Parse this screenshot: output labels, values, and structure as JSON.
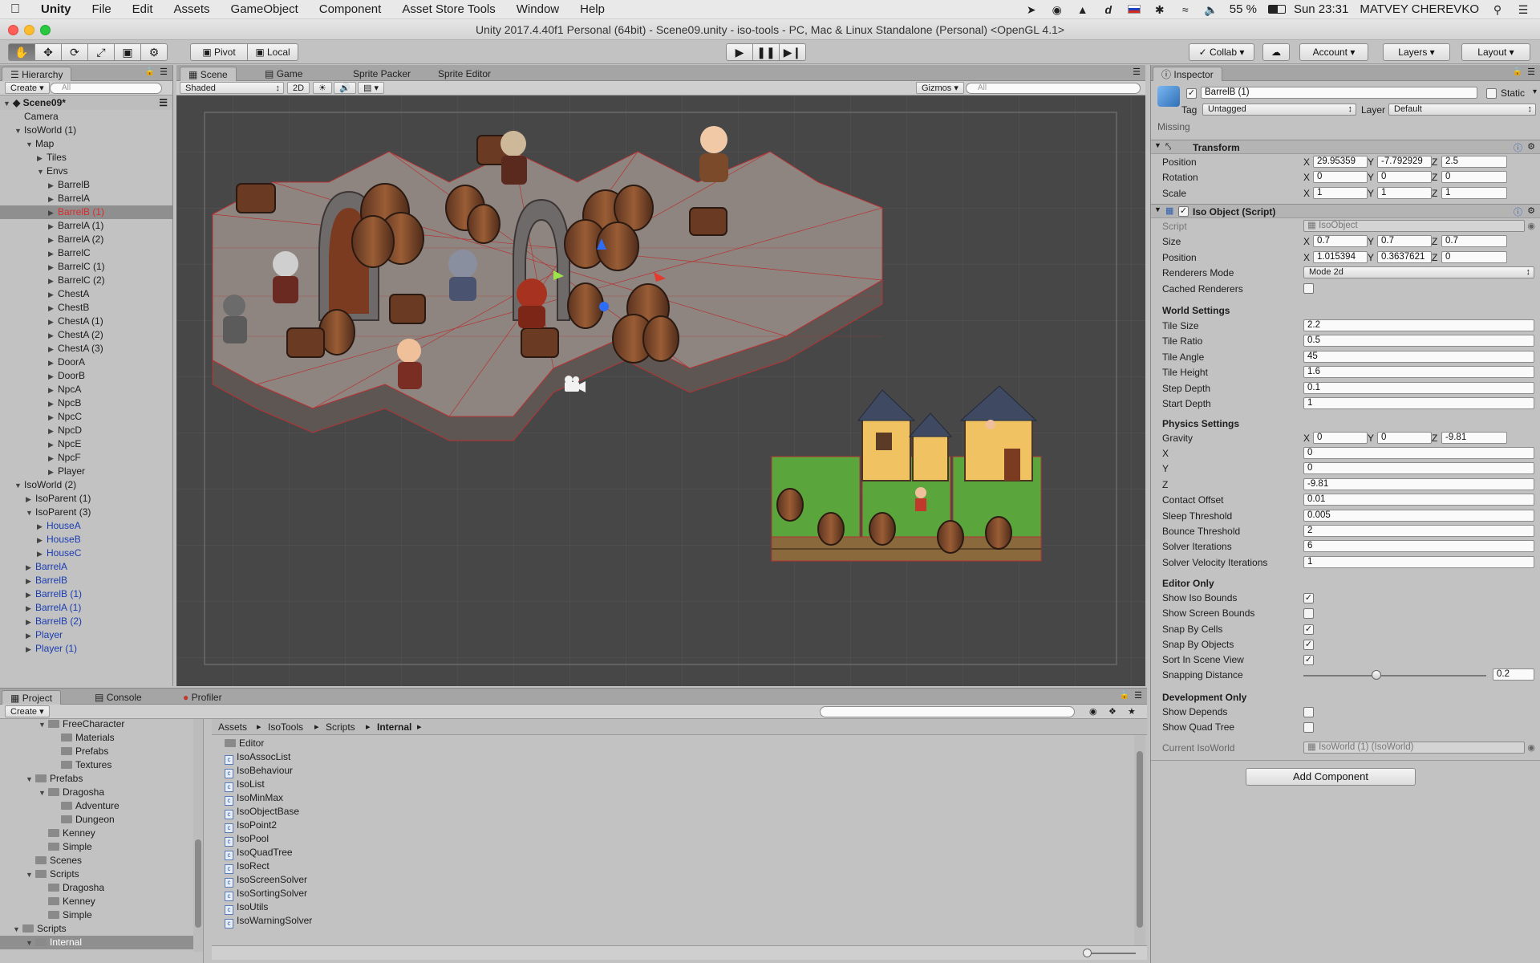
{
  "menubar": {
    "app": "Unity",
    "items": [
      "File",
      "Edit",
      "Assets",
      "GameObject",
      "Component",
      "Asset Store Tools",
      "Window",
      "Help"
    ],
    "battery": "55 %",
    "clock": "Sun 23:31",
    "user": "MATVEY CHEREVKO"
  },
  "window": {
    "title": "Unity 2017.4.40f1 Personal (64bit) - Scene09.unity - iso-tools - PC, Mac & Linux Standalone (Personal) <OpenGL 4.1>"
  },
  "toolbar": {
    "pivot": "Pivot",
    "local": "Local",
    "collab": "Collab",
    "account": "Account",
    "layers": "Layers",
    "layout": "Layout"
  },
  "hierarchy": {
    "tab": "Hierarchy",
    "create": "Create",
    "search_placeholder": "All",
    "scene": "Scene09*",
    "rows": [
      {
        "label": "Camera",
        "indent": 1,
        "arrow": "",
        "blue": false,
        "sel": false
      },
      {
        "label": "IsoWorld (1)",
        "indent": 1,
        "arrow": "▼",
        "blue": false,
        "sel": false
      },
      {
        "label": "Map",
        "indent": 2,
        "arrow": "▼",
        "blue": false,
        "sel": false
      },
      {
        "label": "Tiles",
        "indent": 3,
        "arrow": "▶",
        "blue": false,
        "sel": false
      },
      {
        "label": "Envs",
        "indent": 3,
        "arrow": "▼",
        "blue": false,
        "sel": false
      },
      {
        "label": "BarrelB",
        "indent": 4,
        "arrow": "▶",
        "blue": false,
        "sel": false
      },
      {
        "label": "BarrelA",
        "indent": 4,
        "arrow": "▶",
        "blue": false,
        "sel": false
      },
      {
        "label": "BarrelB (1)",
        "indent": 4,
        "arrow": "▶",
        "blue": false,
        "sel": true
      },
      {
        "label": "BarrelA (1)",
        "indent": 4,
        "arrow": "▶",
        "blue": false,
        "sel": false
      },
      {
        "label": "BarrelA (2)",
        "indent": 4,
        "arrow": "▶",
        "blue": false,
        "sel": false
      },
      {
        "label": "BarrelC",
        "indent": 4,
        "arrow": "▶",
        "blue": false,
        "sel": false
      },
      {
        "label": "BarrelC (1)",
        "indent": 4,
        "arrow": "▶",
        "blue": false,
        "sel": false
      },
      {
        "label": "BarrelC (2)",
        "indent": 4,
        "arrow": "▶",
        "blue": false,
        "sel": false
      },
      {
        "label": "ChestA",
        "indent": 4,
        "arrow": "▶",
        "blue": false,
        "sel": false
      },
      {
        "label": "ChestB",
        "indent": 4,
        "arrow": "▶",
        "blue": false,
        "sel": false
      },
      {
        "label": "ChestA (1)",
        "indent": 4,
        "arrow": "▶",
        "blue": false,
        "sel": false
      },
      {
        "label": "ChestA (2)",
        "indent": 4,
        "arrow": "▶",
        "blue": false,
        "sel": false
      },
      {
        "label": "ChestA (3)",
        "indent": 4,
        "arrow": "▶",
        "blue": false,
        "sel": false
      },
      {
        "label": "DoorA",
        "indent": 4,
        "arrow": "▶",
        "blue": false,
        "sel": false
      },
      {
        "label": "DoorB",
        "indent": 4,
        "arrow": "▶",
        "blue": false,
        "sel": false
      },
      {
        "label": "NpcA",
        "indent": 4,
        "arrow": "▶",
        "blue": false,
        "sel": false
      },
      {
        "label": "NpcB",
        "indent": 4,
        "arrow": "▶",
        "blue": false,
        "sel": false
      },
      {
        "label": "NpcC",
        "indent": 4,
        "arrow": "▶",
        "blue": false,
        "sel": false
      },
      {
        "label": "NpcD",
        "indent": 4,
        "arrow": "▶",
        "blue": false,
        "sel": false
      },
      {
        "label": "NpcE",
        "indent": 4,
        "arrow": "▶",
        "blue": false,
        "sel": false
      },
      {
        "label": "NpcF",
        "indent": 4,
        "arrow": "▶",
        "blue": false,
        "sel": false
      },
      {
        "label": "Player",
        "indent": 4,
        "arrow": "▶",
        "blue": false,
        "sel": false
      },
      {
        "label": "IsoWorld (2)",
        "indent": 1,
        "arrow": "▼",
        "blue": false,
        "sel": false
      },
      {
        "label": "IsoParent (1)",
        "indent": 2,
        "arrow": "▶",
        "blue": false,
        "sel": false
      },
      {
        "label": "IsoParent (3)",
        "indent": 2,
        "arrow": "▼",
        "blue": false,
        "sel": false
      },
      {
        "label": "HouseA",
        "indent": 3,
        "arrow": "▶",
        "blue": true,
        "sel": false
      },
      {
        "label": "HouseB",
        "indent": 3,
        "arrow": "▶",
        "blue": true,
        "sel": false
      },
      {
        "label": "HouseC",
        "indent": 3,
        "arrow": "▶",
        "blue": true,
        "sel": false
      },
      {
        "label": "BarrelA",
        "indent": 2,
        "arrow": "▶",
        "blue": true,
        "sel": false
      },
      {
        "label": "BarrelB",
        "indent": 2,
        "arrow": "▶",
        "blue": true,
        "sel": false
      },
      {
        "label": "BarrelB (1)",
        "indent": 2,
        "arrow": "▶",
        "blue": true,
        "sel": false
      },
      {
        "label": "BarrelA (1)",
        "indent": 2,
        "arrow": "▶",
        "blue": true,
        "sel": false
      },
      {
        "label": "BarrelB (2)",
        "indent": 2,
        "arrow": "▶",
        "blue": true,
        "sel": false
      },
      {
        "label": "Player",
        "indent": 2,
        "arrow": "▶",
        "blue": true,
        "sel": false
      },
      {
        "label": "Player (1)",
        "indent": 2,
        "arrow": "▶",
        "blue": true,
        "sel": false
      }
    ]
  },
  "scene": {
    "tabs": [
      "Scene",
      "Game",
      "Sprite Packer",
      "Sprite Editor"
    ],
    "shading": "Shaded",
    "mode2d": "2D",
    "gizmos": "Gizmos",
    "search_placeholder": "All"
  },
  "inspector": {
    "tab": "Inspector",
    "object_name": "BarrelB (1)",
    "static_label": "Static",
    "tag_label": "Tag",
    "tag": "Untagged",
    "layer_label": "Layer",
    "layer": "Default",
    "missing": "Missing",
    "transform": {
      "title": "Transform",
      "position_label": "Position",
      "position": [
        "29.95359",
        "-7.792929",
        "2.5"
      ],
      "rotation_label": "Rotation",
      "rotation": [
        "0",
        "0",
        "0"
      ],
      "scale_label": "Scale",
      "scale": [
        "1",
        "1",
        "1"
      ]
    },
    "isoobject": {
      "title": "Iso Object (Script)",
      "script_label": "Script",
      "script": "IsoObject",
      "size_label": "Size",
      "size": [
        "0.7",
        "0.7",
        "0.7"
      ],
      "position_label": "Position",
      "position": [
        "1.015394",
        "0.3637621",
        "0"
      ],
      "renderers_mode_label": "Renderers Mode",
      "renderers_mode": "Mode 2d",
      "cached_renderers_label": "Cached Renderers"
    },
    "world_settings": {
      "title": "World Settings",
      "fields": [
        {
          "label": "Tile Size",
          "value": "2.2"
        },
        {
          "label": "Tile Ratio",
          "value": "0.5"
        },
        {
          "label": "Tile Angle",
          "value": "45"
        },
        {
          "label": "Tile Height",
          "value": "1.6"
        },
        {
          "label": "Step Depth",
          "value": "0.1"
        },
        {
          "label": "Start Depth",
          "value": "1"
        }
      ]
    },
    "physics_settings": {
      "title": "Physics Settings",
      "gravity_label": "Gravity",
      "gravity": [
        "0",
        "0",
        "-9.81"
      ],
      "fields": [
        {
          "label": "X",
          "value": "0"
        },
        {
          "label": "Y",
          "value": "0"
        },
        {
          "label": "Z",
          "value": "-9.81"
        },
        {
          "label": "Contact Offset",
          "value": "0.01"
        },
        {
          "label": "Sleep Threshold",
          "value": "0.005"
        },
        {
          "label": "Bounce Threshold",
          "value": "2"
        },
        {
          "label": "Solver Iterations",
          "value": "6"
        },
        {
          "label": "Solver Velocity Iterations",
          "value": "1"
        }
      ]
    },
    "editor_only": {
      "title": "Editor Only",
      "checks": [
        {
          "label": "Show Iso Bounds",
          "checked": true
        },
        {
          "label": "Show Screen Bounds",
          "checked": false
        },
        {
          "label": "Snap By Cells",
          "checked": true
        },
        {
          "label": "Snap By Objects",
          "checked": true
        },
        {
          "label": "Sort In Scene View",
          "checked": true
        }
      ],
      "snapping_label": "Snapping Distance",
      "snapping_value": "0.2",
      "snapping_fraction": 0.4
    },
    "development_only": {
      "title": "Development Only",
      "checks": [
        {
          "label": "Show Depends",
          "checked": false
        },
        {
          "label": "Show Quad Tree",
          "checked": false
        }
      ]
    },
    "current_isoworld_label": "Current IsoWorld",
    "current_isoworld": "IsoWorld (1) (IsoWorld)",
    "add_component": "Add Component"
  },
  "project": {
    "tabs": [
      "Project",
      "Console",
      "Profiler"
    ],
    "create": "Create",
    "tree": [
      {
        "label": "FreeCharacter",
        "indent": 3,
        "arrow": "▼",
        "sel": false
      },
      {
        "label": "Materials",
        "indent": 4,
        "arrow": "",
        "sel": false
      },
      {
        "label": "Prefabs",
        "indent": 4,
        "arrow": "",
        "sel": false
      },
      {
        "label": "Textures",
        "indent": 4,
        "arrow": "",
        "sel": false
      },
      {
        "label": "Prefabs",
        "indent": 2,
        "arrow": "▼",
        "sel": false
      },
      {
        "label": "Dragosha",
        "indent": 3,
        "arrow": "▼",
        "sel": false
      },
      {
        "label": "Adventure",
        "indent": 4,
        "arrow": "",
        "sel": false
      },
      {
        "label": "Dungeon",
        "indent": 4,
        "arrow": "",
        "sel": false
      },
      {
        "label": "Kenney",
        "indent": 3,
        "arrow": "",
        "sel": false
      },
      {
        "label": "Simple",
        "indent": 3,
        "arrow": "",
        "sel": false
      },
      {
        "label": "Scenes",
        "indent": 2,
        "arrow": "",
        "sel": false
      },
      {
        "label": "Scripts",
        "indent": 2,
        "arrow": "▼",
        "sel": false
      },
      {
        "label": "Dragosha",
        "indent": 3,
        "arrow": "",
        "sel": false
      },
      {
        "label": "Kenney",
        "indent": 3,
        "arrow": "",
        "sel": false
      },
      {
        "label": "Simple",
        "indent": 3,
        "arrow": "",
        "sel": false
      },
      {
        "label": "Scripts",
        "indent": 1,
        "arrow": "▼",
        "sel": false
      },
      {
        "label": "Internal",
        "indent": 2,
        "arrow": "▼",
        "sel": true
      }
    ],
    "breadcrumb": [
      "Assets",
      "IsoTools",
      "Scripts",
      "Internal"
    ],
    "files": [
      {
        "label": "Editor",
        "folder": true
      },
      {
        "label": "IsoAssocList",
        "folder": false
      },
      {
        "label": "IsoBehaviour",
        "folder": false
      },
      {
        "label": "IsoList",
        "folder": false
      },
      {
        "label": "IsoMinMax",
        "folder": false
      },
      {
        "label": "IsoObjectBase",
        "folder": false
      },
      {
        "label": "IsoPoint2",
        "folder": false
      },
      {
        "label": "IsoPool",
        "folder": false
      },
      {
        "label": "IsoQuadTree",
        "folder": false
      },
      {
        "label": "IsoRect",
        "folder": false
      },
      {
        "label": "IsoScreenSolver",
        "folder": false
      },
      {
        "label": "IsoSortingSolver",
        "folder": false
      },
      {
        "label": "IsoUtils",
        "folder": false
      },
      {
        "label": "IsoWarningSolver",
        "folder": false
      }
    ]
  }
}
